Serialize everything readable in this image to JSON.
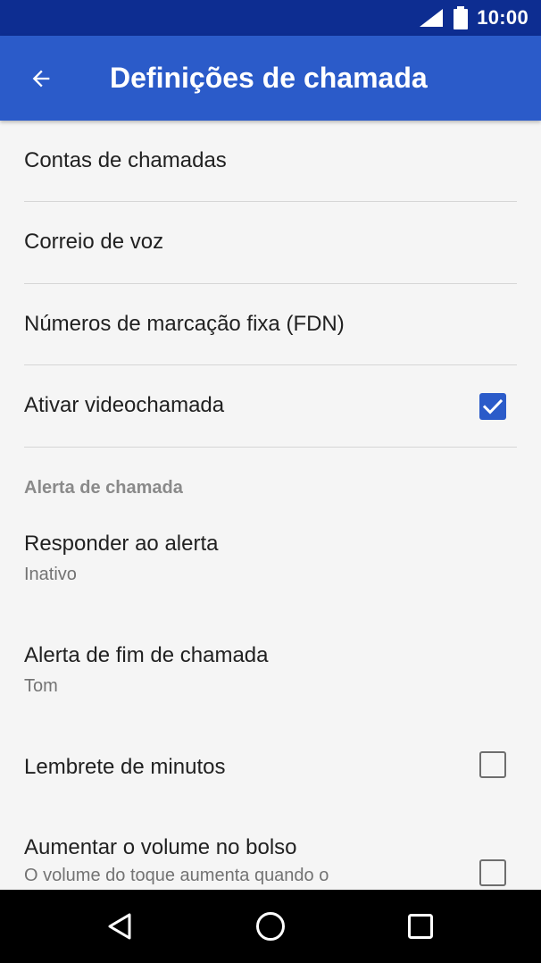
{
  "status_bar": {
    "time": "10:00",
    "icons": [
      "signal-icon",
      "battery-icon"
    ]
  },
  "app_bar": {
    "title": "Definições de chamada",
    "back_icon": "arrow-back-icon"
  },
  "settings": {
    "contas": {
      "title": "Contas de chamadas"
    },
    "correio": {
      "title": "Correio de voz"
    },
    "fdn": {
      "title": "Números de marcação fixa (FDN)"
    },
    "video": {
      "title": "Ativar videochamada",
      "checked": true
    },
    "section_alerta": "Alerta de chamada",
    "responder": {
      "title": "Responder ao alerta",
      "subtitle": "Inativo"
    },
    "fim": {
      "title": "Alerta de fim de chamada",
      "subtitle": "Tom"
    },
    "lembrete": {
      "title": "Lembrete de minutos",
      "checked": false
    },
    "volume": {
      "title": "Aumentar o volume no bolso",
      "subtitle": "O volume do toque aumenta quando o",
      "checked": false
    }
  },
  "nav_bar": {
    "icons": [
      "back-triangle-icon",
      "home-circle-icon",
      "recents-square-icon"
    ]
  },
  "colors": {
    "status_bar": "#0d2d91",
    "app_bar": "#2b5bc9",
    "background": "#f5f5f5",
    "accent": "#2b5bc9"
  }
}
